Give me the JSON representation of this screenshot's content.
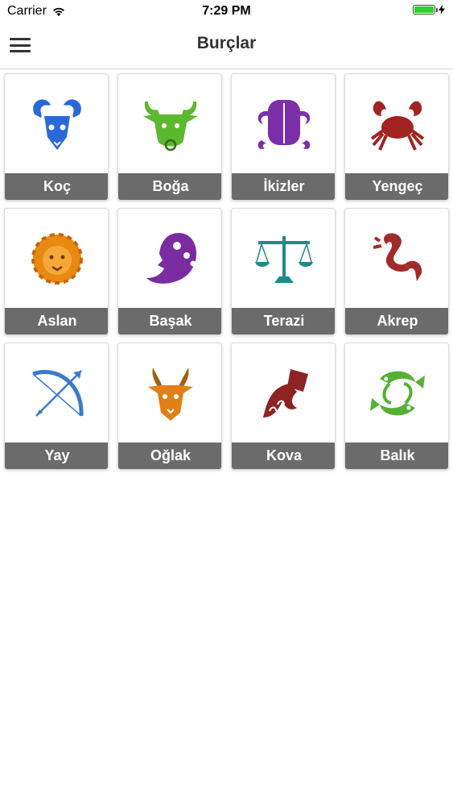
{
  "status_bar": {
    "carrier": "Carrier",
    "time": "7:29 PM",
    "battery_level": 1.0
  },
  "nav": {
    "title": "Burçlar",
    "menu_icon": "hamburger-menu-icon"
  },
  "signs": [
    {
      "label": "Koç",
      "icon": "aries-ram-icon",
      "color": "#2a6ad8"
    },
    {
      "label": "Boğa",
      "icon": "taurus-bull-icon",
      "color": "#5cb82e"
    },
    {
      "label": "İkizler",
      "icon": "gemini-twins-icon",
      "color": "#7b2fa8"
    },
    {
      "label": "Yengeç",
      "icon": "cancer-crab-icon",
      "color": "#a12422"
    },
    {
      "label": "Aslan",
      "icon": "leo-lion-icon",
      "color": "#e88a12"
    },
    {
      "label": "Başak",
      "icon": "virgo-maiden-icon",
      "color": "#7a2ca0"
    },
    {
      "label": "Terazi",
      "icon": "libra-scales-icon",
      "color": "#1f8a8a"
    },
    {
      "label": "Akrep",
      "icon": "scorpio-scorpion-icon",
      "color": "#a32a2a"
    },
    {
      "label": "Yay",
      "icon": "sagittarius-bow-icon",
      "color": "#3b7bc9"
    },
    {
      "label": "Oğlak",
      "icon": "capricorn-goat-icon",
      "color": "#e27f16"
    },
    {
      "label": "Kova",
      "icon": "aquarius-water-bearer-icon",
      "color": "#8e2323"
    },
    {
      "label": "Balık",
      "icon": "pisces-fish-icon",
      "color": "#55b133"
    }
  ]
}
